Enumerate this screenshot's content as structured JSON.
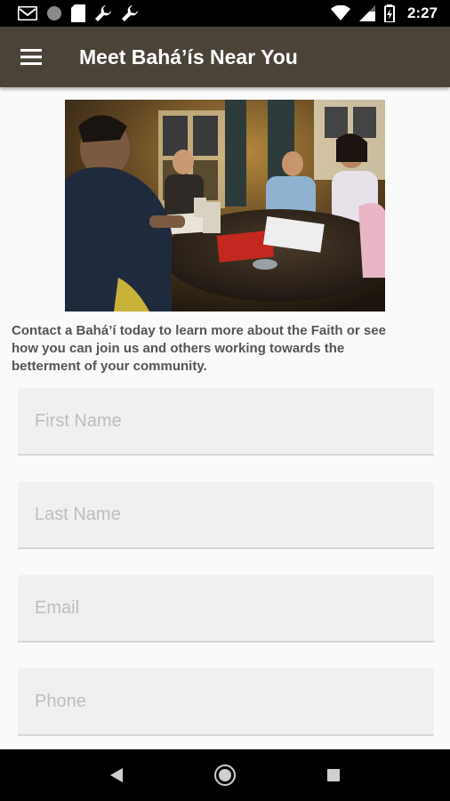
{
  "status_bar": {
    "time": "2:27",
    "left_icons": [
      "gmail-icon",
      "circle-icon",
      "sd-card-icon",
      "wrench-icon",
      "wrench-icon"
    ],
    "right_icons": [
      "wifi-icon",
      "signal-icon",
      "battery-icon"
    ]
  },
  "app_bar": {
    "title": "Meet Bahá’ís Near You",
    "menu_icon": "menu-icon",
    "color": "#4b4338"
  },
  "main": {
    "intro_text": "Contact a Bahá’í today to learn more about the Faith or see how you can join us and others working towards the betterment of your community.",
    "form": {
      "first_name": {
        "placeholder": "First Name",
        "value": ""
      },
      "last_name": {
        "placeholder": "Last Name",
        "value": ""
      },
      "email": {
        "placeholder": "Email",
        "value": ""
      },
      "phone": {
        "placeholder": "Phone",
        "value": ""
      }
    }
  },
  "nav_bar": {
    "buttons": [
      "back-icon",
      "home-icon",
      "recents-icon"
    ]
  }
}
